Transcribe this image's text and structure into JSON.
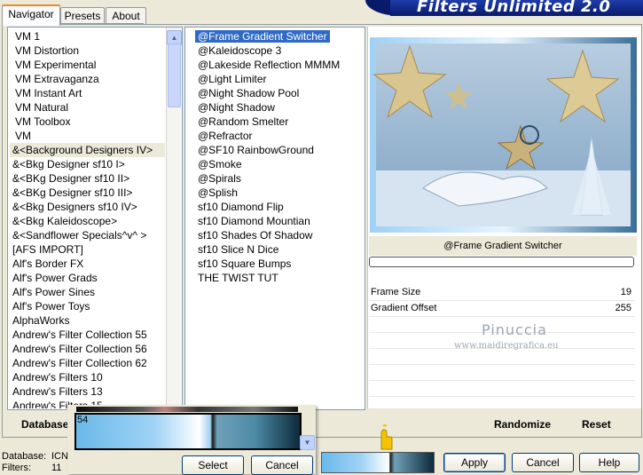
{
  "window": {
    "title": "Filters Unlimited 2.0"
  },
  "tabs": [
    {
      "label": "Navigator"
    },
    {
      "label": "Presets"
    },
    {
      "label": "About"
    }
  ],
  "categories": [
    "VM 1",
    "VM Distortion",
    "VM Experimental",
    "VM Extravaganza",
    "VM Instant Art",
    "VM Natural",
    "VM Toolbox",
    "VM",
    "&<Background Designers IV>",
    "&<Bkg Designer sf10 I>",
    "&<BKg Designer sf10 II>",
    "&<BKg Designer sf10 III>",
    "&<Bkg Designers sf10 IV>",
    "&<Bkg Kaleidoscope>",
    "&<Sandflower Specials^v^ >",
    "[AFS IMPORT]",
    "Alf's Border FX",
    "Alf's Power Grads",
    "Alf's Power Sines",
    "Alf's Power Toys",
    "AlphaWorks",
    "Andrew's Filter Collection 55",
    "Andrew's Filter Collection 56",
    "Andrew's Filter Collection 62",
    "Andrew's Filters 10",
    "Andrew's Filters 13",
    "Andrew's Filters 15"
  ],
  "filters": [
    "@Frame Gradient Switcher",
    "@Kaleidoscope 3",
    "@Lakeside Reflection MMMM",
    "@Light Limiter",
    "@Night Shadow Pool",
    "@Night Shadow",
    "@Random Smelter",
    "@Refractor",
    "@SF10 RainbowGround",
    "@Smoke",
    "@Spirals",
    "@Splish",
    "sf10 Diamond Flip",
    "sf10 Diamond Mountian",
    "sf10 Shades Of Shadow",
    "sf10 Slice N Dice",
    "sf10 Square Bumps",
    "THE TWIST TUT"
  ],
  "preview": {
    "filter_name": "@Frame Gradient Switcher"
  },
  "params": [
    {
      "label": "Frame Size",
      "value": "19"
    },
    {
      "label": "Gradient Offset",
      "value": "255"
    }
  ],
  "watermark": {
    "name": "Pinuccia",
    "url": "www.maidiregrafica.eu"
  },
  "buttons": {
    "database": "Database",
    "randomize": "Randomize",
    "reset": "Reset",
    "select": "Select",
    "cancel_popup": "Cancel",
    "apply": "Apply",
    "cancel": "Cancel",
    "help": "Help"
  },
  "status": {
    "database_label": "Database:",
    "database_value": "ICN",
    "filters_label": "Filters:",
    "filters_value": "11"
  },
  "gradient_popup": {
    "value": "54"
  },
  "colors": {
    "selection": "#316ac5",
    "banner": "#0a1a6b",
    "gradient_light": "#8fc8f0",
    "gradient_dark": "#0d2a3a"
  }
}
